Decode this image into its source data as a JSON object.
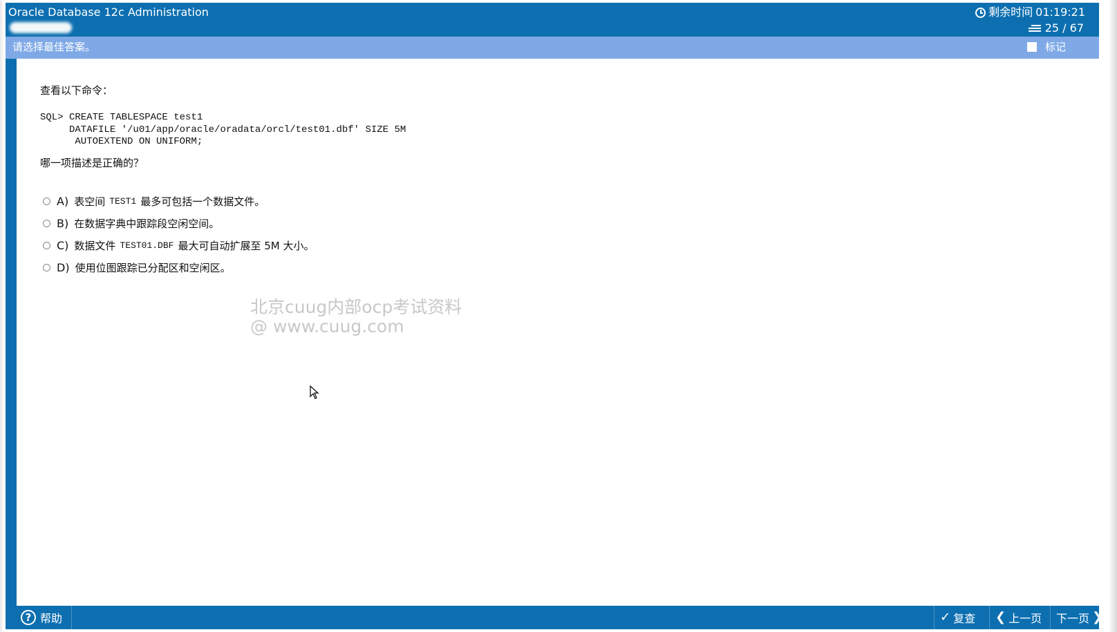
{
  "header": {
    "app_title": "Oracle Database 12c Administration",
    "timer_label": "剩余时间",
    "timer_value": "01:19:21",
    "progress": "25 / 67"
  },
  "instruction_bar": {
    "text": "请选择最佳答案。",
    "mark_label": "标记"
  },
  "question": {
    "intro": "查看以下命令：",
    "code_lines": [
      "SQL> CREATE TABLESPACE test1",
      "     DATAFILE '/u01/app/oracle/oradata/orcl/test01.dbf' SIZE 5M",
      "      AUTOEXTEND ON UNIFORM;"
    ],
    "ask": "哪一项描述是正确的？",
    "options": [
      {
        "letter": "A)",
        "pre": "表空间",
        "mono": "TEST1",
        "post": "最多可包括一个数据文件。"
      },
      {
        "letter": "B)",
        "pre": "在数据字典中跟踪段空闲空间。",
        "mono": "",
        "post": ""
      },
      {
        "letter": "C)",
        "pre": "数据文件",
        "mono": "TEST01.DBF",
        "post": "最大可自动扩展至 5M 大小。"
      },
      {
        "letter": "D)",
        "pre": "使用位图跟踪已分配区和空闲区。",
        "mono": "",
        "post": ""
      }
    ]
  },
  "watermark": {
    "line1": "北京cuug内部ocp考试资料",
    "line2": "@ www.cuug.com"
  },
  "footer": {
    "help_label": "帮助",
    "review_label": "复查",
    "prev_label": "上一页",
    "next_label": "下一页"
  },
  "icons": {
    "timer": "clock-icon",
    "progress": "list-icon",
    "help": "question-circle-icon",
    "review": "check-icon",
    "prev": "arrow-left-icon",
    "next": "arrow-right-icon",
    "cursor": "mouse-pointer-icon"
  },
  "colors": {
    "header_blue": "#0d6fb0",
    "instruction_blue": "#7fa9e6",
    "watermark_gray": "#c8c8c8"
  }
}
